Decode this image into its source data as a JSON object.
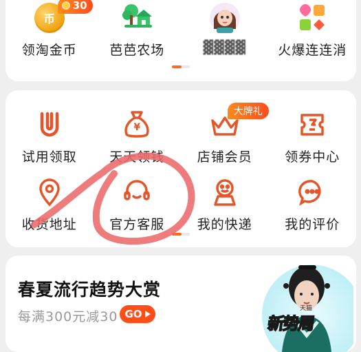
{
  "row1": {
    "items": [
      {
        "label": "领淘金币",
        "icon": "gold-coin-icon",
        "coin_text": "币",
        "badge": "30"
      },
      {
        "label": "芭芭农场",
        "icon": "farm-house-icon"
      },
      {
        "label": "",
        "icon": "avatar-doll-icon"
      },
      {
        "label": "火爆连连消",
        "icon": "match-game-icon"
      }
    ]
  },
  "services": {
    "items": [
      {
        "label": "试用领取",
        "icon": "trial-u-icon"
      },
      {
        "label": "天天领钱",
        "icon": "money-bag-icon",
        "icon_text": "¥"
      },
      {
        "label": "店铺会员",
        "icon": "crown-icon",
        "badge": "大牌礼"
      },
      {
        "label": "领券中心",
        "icon": "coupon-icon"
      },
      {
        "label": "收货地址",
        "icon": "location-pin-icon"
      },
      {
        "label": "官方客服",
        "icon": "headset-icon"
      },
      {
        "label": "我的快递",
        "icon": "courier-icon"
      },
      {
        "label": "我的评价",
        "icon": "comment-icon"
      }
    ]
  },
  "promo": {
    "title": "春夏流行趋势大赏",
    "subtitle": "每满300元减30",
    "button": "GO",
    "stamp": "新势周",
    "brand": "天猫"
  },
  "colors": {
    "accent": "#ff5b1f",
    "icon_stroke": "#e4562a",
    "annotation": "#ec6a6a"
  }
}
